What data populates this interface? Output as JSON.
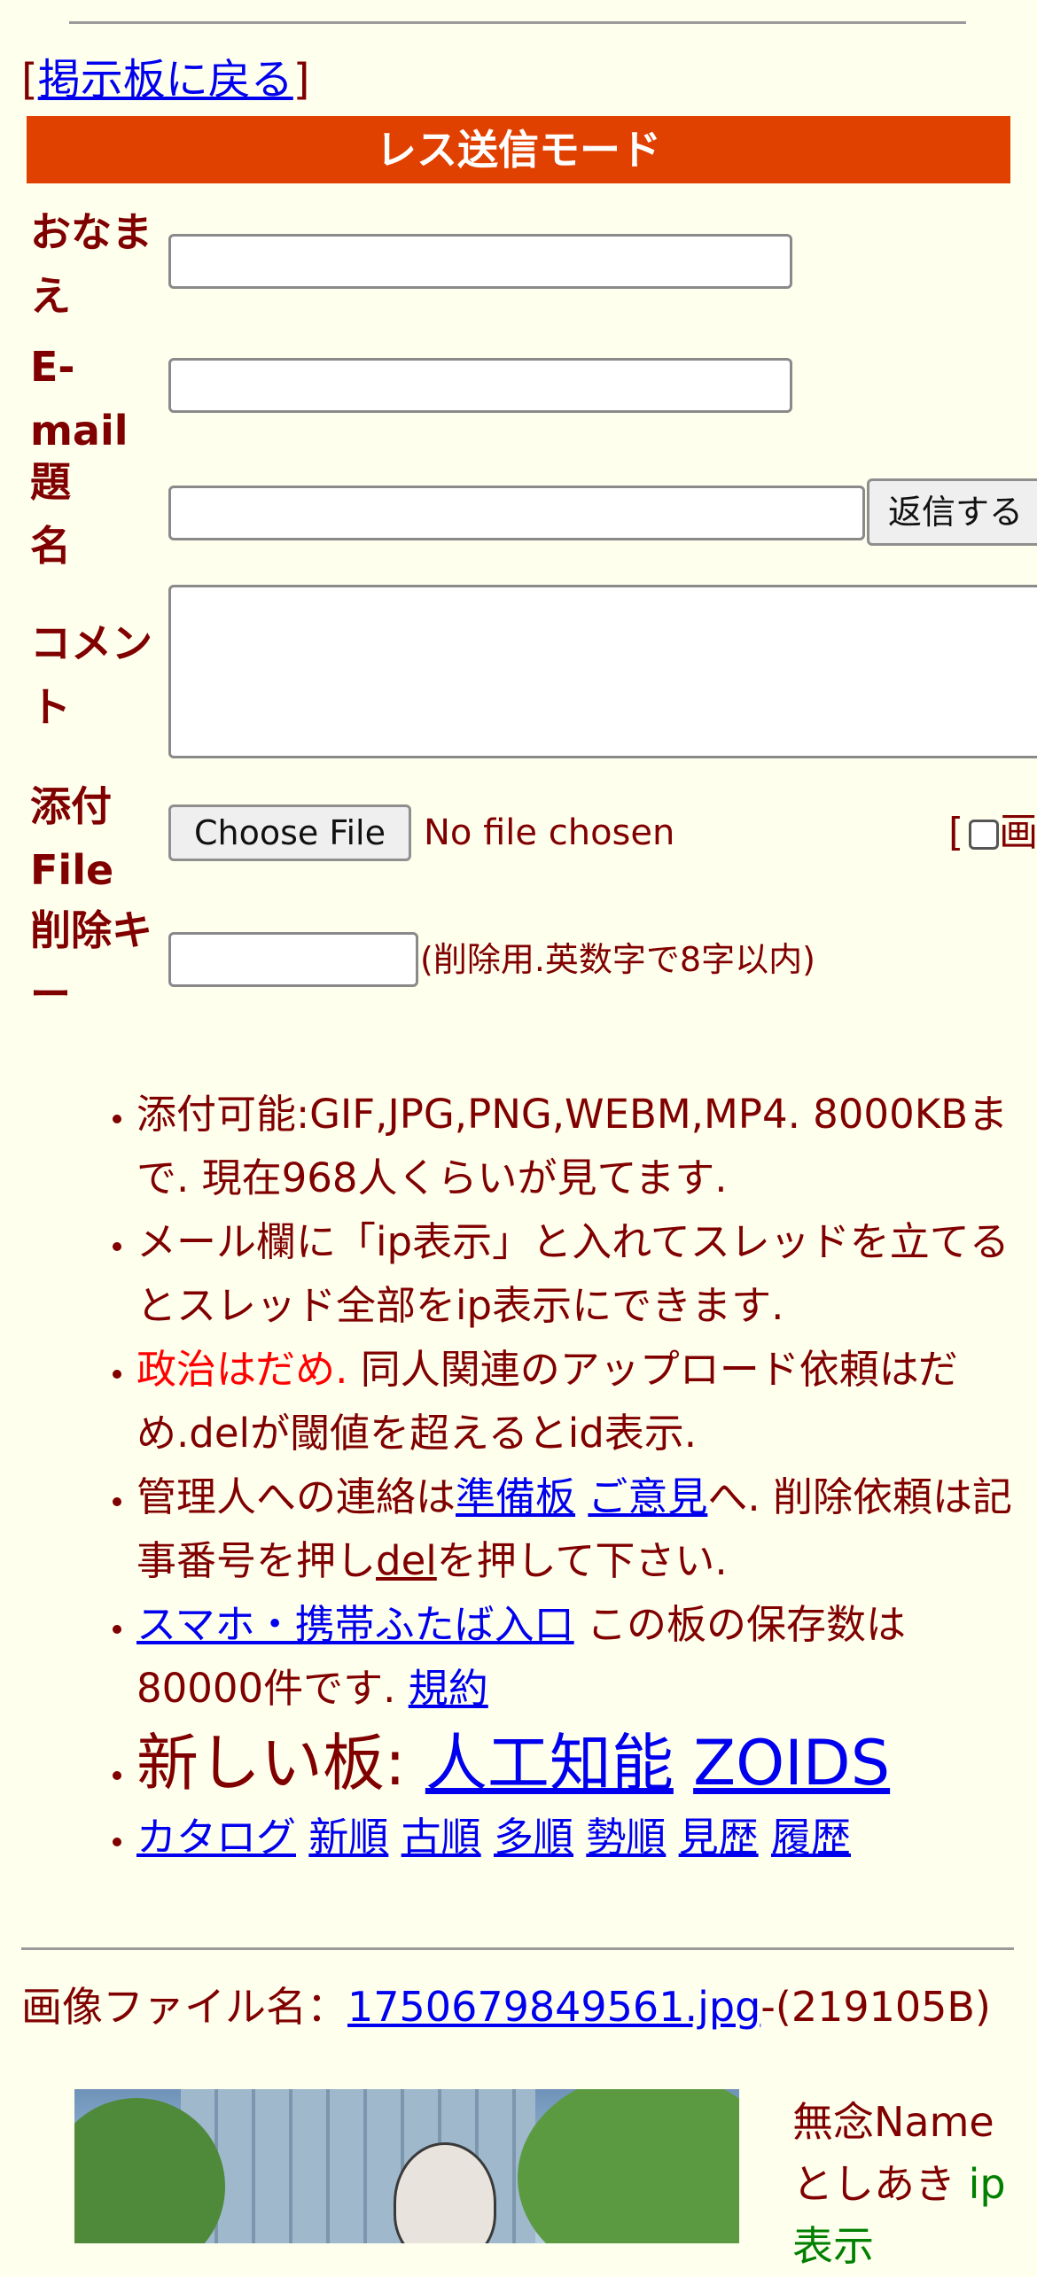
{
  "back_link": {
    "prefix": "[",
    "label": "掲示板に戻る",
    "suffix": "]"
  },
  "mode_bar": "レス送信モード",
  "form": {
    "name_label": "おなまえ",
    "email_label": "E-mail",
    "subject_label": "題名",
    "comment_label": "コメント",
    "file_label": "添付File",
    "delkey_label": "削除キー",
    "reply_button": "返信する",
    "choose_file_button": "Choose File",
    "no_file_text": "No file chosen",
    "image_option_prefix": "[",
    "image_option_text": "画",
    "delkey_hint": "(削除用.英数字で8字以内)"
  },
  "rules": {
    "r1": "添付可能:GIF,JPG,PNG,WEBM,MP4. 8000KBまで. 現在968人くらいが見てます.",
    "r2": "メール欄に「ip表示」と入れてスレッドを立てるとスレッド全部をip表示にできます.",
    "r3_red": "政治はだめ.",
    "r3_rest": " 同人関連のアップロード依頼はだめ.delが閾値を超えるとid表示.",
    "r4_a": "管理人への連絡は",
    "r4_link1": "準備板",
    "r4_link2": "ご意見",
    "r4_b": "へ. 削除依頼は記事番号を押し",
    "r4_link3": "del",
    "r4_c": "を押して下さい.",
    "r5_link": "スマホ・携帯ふたば入口",
    "r5_text": " この板の保存数は80000件です. ",
    "r5_link2": "規約",
    "r6_prefix": "新しい板: ",
    "r6_link1": "人工知能",
    "r6_link2": "ZOIDS",
    "nav": [
      "カタログ",
      "新順",
      "古順",
      "多順",
      "勢順",
      "見歴",
      "履歴"
    ]
  },
  "post": {
    "file_prefix": "画像ファイル名：",
    "file_name": "1750679849561.jpg",
    "file_size": "-(219105B)",
    "name_line1": "無念Name",
    "name_line2": "としあき",
    "ip": "ip表示"
  }
}
